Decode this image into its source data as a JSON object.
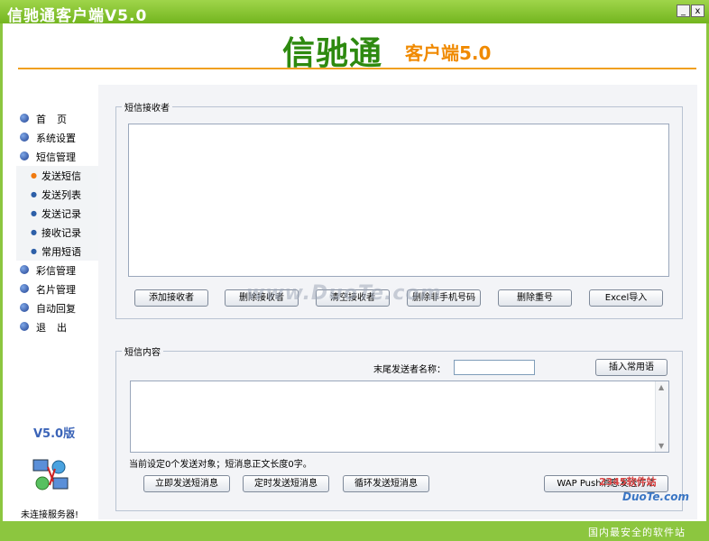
{
  "window": {
    "title": "信驰通客户端V5.0",
    "minimize_label": "_",
    "close_label": "x"
  },
  "header": {
    "logo_main": "信驰通",
    "logo_sub": "客户端5.0"
  },
  "sidebar": {
    "items": [
      {
        "label": "首页"
      },
      {
        "label": "系统设置"
      },
      {
        "label": "短信管理"
      }
    ],
    "sub_items": [
      {
        "label": "发送短信"
      },
      {
        "label": "发送列表"
      },
      {
        "label": "发送记录"
      },
      {
        "label": "接收记录"
      },
      {
        "label": "常用短语"
      }
    ],
    "items_after": [
      {
        "label": "彩信管理"
      },
      {
        "label": "名片管理"
      },
      {
        "label": "自动回复"
      },
      {
        "label": "退出"
      }
    ],
    "version": "V5.0版",
    "connection_status": "未连接服务器!"
  },
  "recipients": {
    "title": "短信接收者",
    "buttons": [
      "添加接收者",
      "删除接收者",
      "清空接收者",
      "删除非手机号码",
      "删除重号",
      "Excel导入"
    ]
  },
  "content": {
    "title": "短信内容",
    "sender_label": "末尾发送者名称：",
    "sender_value": "",
    "insert_button": "插入常用语",
    "status_text": "当前设定0个发送对象；短消息正文长度0字。",
    "send_buttons": [
      "立即发送短消息",
      "定时发送短消息",
      "循环发送短消息"
    ],
    "wap_button": "WAP Push消息发送方法"
  },
  "watermarks": {
    "center": "www.DuoTe.com",
    "corner_top": "2345软件站",
    "corner_logo": "DuoTe.com",
    "bottom": "国内最安全的软件站"
  }
}
